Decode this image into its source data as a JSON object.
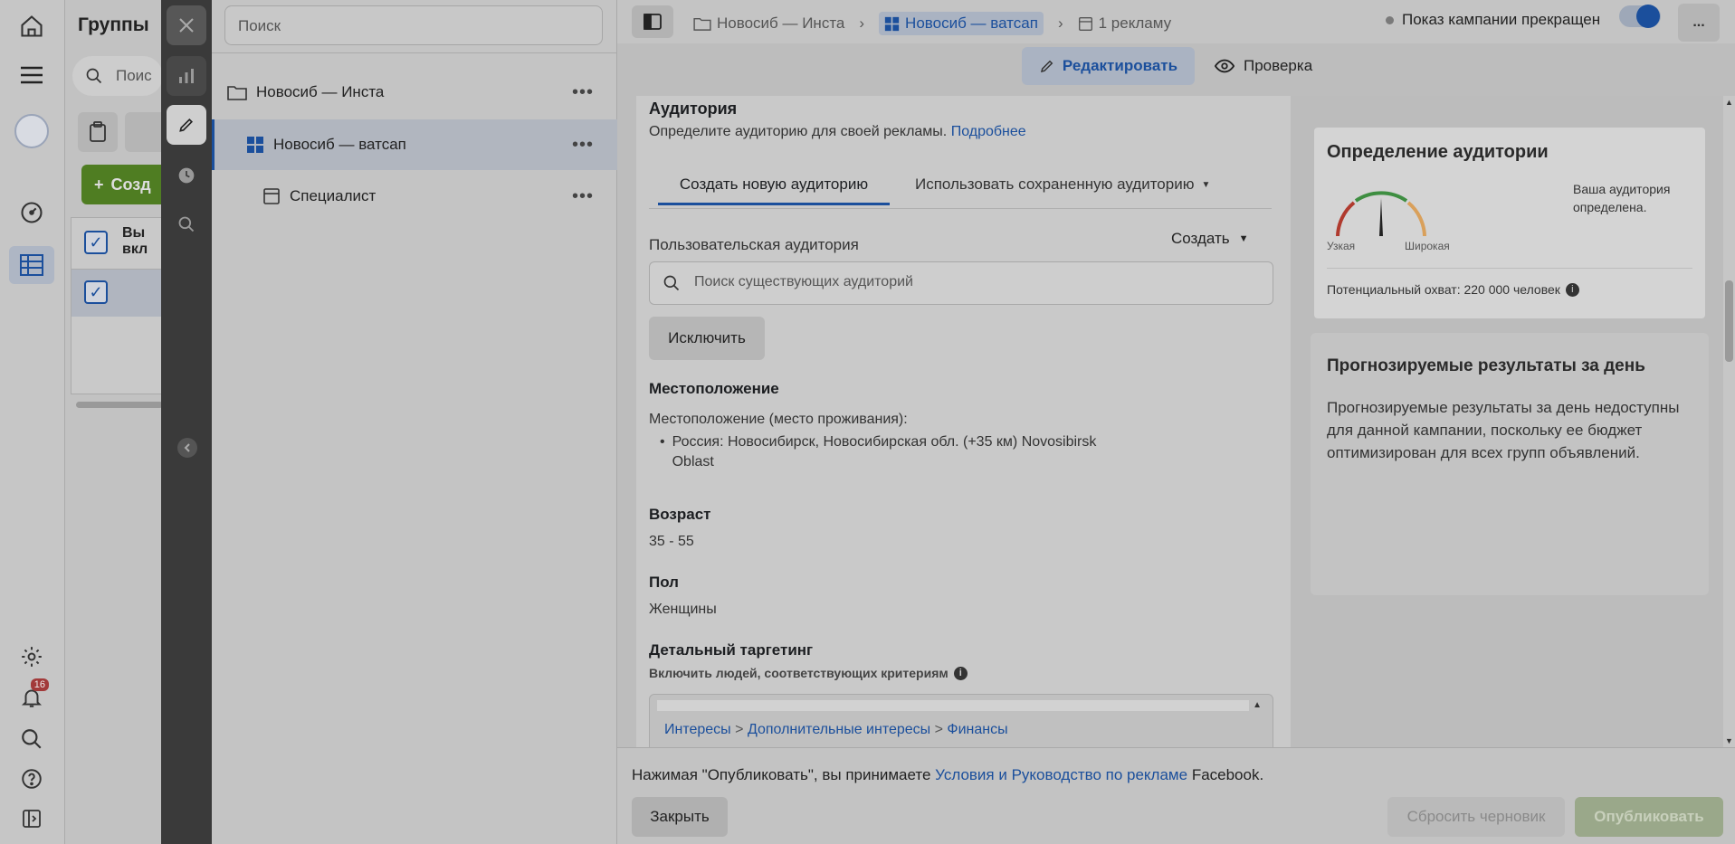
{
  "rail": {
    "notifications_count": "16"
  },
  "underlying": {
    "title": "Группы",
    "search_placeholder": "Поис",
    "create_label": "Созд",
    "col_header": "Вы вкл"
  },
  "tree": {
    "search_placeholder": "Поиск",
    "items": [
      {
        "label": "Новосиб — Инста",
        "icon": "folder-icon"
      },
      {
        "label": "Новосиб — ватсап",
        "icon": "grid-icon"
      },
      {
        "label": "Специалист",
        "icon": "ad-icon"
      }
    ]
  },
  "topbar": {
    "crumb1": "Новосиб — Инста",
    "crumb2": "Новосиб — ватсап",
    "crumb3": "1 рекламу",
    "status": "Показ кампании прекращен",
    "more": "..."
  },
  "modes": {
    "edit": "Редактировать",
    "review": "Проверка"
  },
  "audience": {
    "title": "Аудитория",
    "desc": "Определите аудиторию для своей рекламы.",
    "more_link": "Подробнее",
    "tab_new": "Создать новую аудиторию",
    "tab_saved": "Использовать сохраненную аудиторию",
    "custom_label": "Пользовательская аудитория",
    "create_label": "Создать",
    "search_placeholder": "Поиск существующих аудиторий",
    "exclude_button": "Исключить",
    "location_header": "Местоположение",
    "location_sub": "Местоположение (место проживания):",
    "location_item_line1": "Россия: Новосибирск, Новосибирская обл. (+35 км) Novosibirsk",
    "location_item_line2": "Oblast",
    "age_header": "Возраст",
    "age_value": "35 - 55",
    "gender_header": "Пол",
    "gender_value": "Женщины",
    "detailed_header": "Детальный таргетинг",
    "detailed_sub": "Включить людей, соответствующих критериям",
    "path": [
      "Интересы",
      "Дополнительные интересы",
      "Финансы"
    ]
  },
  "definition": {
    "title": "Определение аудитории",
    "narrow": "Узкая",
    "wide": "Широкая",
    "status": "Ваша аудитория определена.",
    "reach": "Потенциальный охват: 220 000 человек",
    "gauge_level": 0.5,
    "colors": {
      "red": "#b03a2e",
      "green": "#3e8e41",
      "orange": "#d9a05b"
    }
  },
  "forecast": {
    "title": "Прогнозируемые результаты за день",
    "text": "Прогнозируемые результаты за день недоступны для данной кампании, поскольку ее бюджет оптимизирован для всех групп объявлений."
  },
  "footer": {
    "notice_pre": "Нажимая \"Опубликовать\", вы принимаете",
    "notice_link": "Условия и Руководство по рекламе",
    "notice_post": "Facebook.",
    "close": "Закрыть",
    "reset": "Сбросить черновик",
    "publish": "Опубликовать"
  }
}
